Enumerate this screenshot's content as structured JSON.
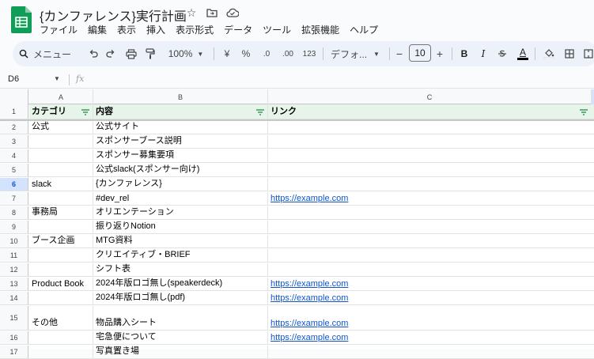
{
  "app": {
    "title": "{カンファレンス}実行計画",
    "brand_color": "#0f9d58"
  },
  "menu": [
    "ファイル",
    "編集",
    "表示",
    "挿入",
    "表示形式",
    "データ",
    "ツール",
    "拡張機能",
    "ヘルプ"
  ],
  "toolbar": {
    "search_label": "メニュー",
    "zoom": "100%",
    "currency": "¥",
    "percent": "%",
    "dec_decrease": ".0",
    "dec_increase": ".00",
    "number_format": "123",
    "font": "デフォ...",
    "font_size": "10",
    "bold": "B",
    "italic": "I"
  },
  "formula_bar": {
    "cell_ref": "D6",
    "fx": "fx"
  },
  "columns": [
    "A",
    "B",
    "C"
  ],
  "header_row": {
    "num": "1",
    "a": "カテゴリ",
    "b": "内容",
    "c": "リンク"
  },
  "rows": [
    {
      "num": "2",
      "a": "公式",
      "b": "公式サイト",
      "c": ""
    },
    {
      "num": "3",
      "a": "",
      "b": "スポンサーブース説明",
      "c": ""
    },
    {
      "num": "4",
      "a": "",
      "b": "スポンサー募集要項",
      "c": ""
    },
    {
      "num": "5",
      "a": "",
      "b": "公式slack(スポンサー向け)",
      "c": ""
    },
    {
      "num": "6",
      "a": "slack",
      "b": "{カンファレンス}",
      "c": ""
    },
    {
      "num": "7",
      "a": "",
      "b": "#dev_rel",
      "c": "https://example.com"
    },
    {
      "num": "8",
      "a": "事務局",
      "b": "オリエンテーション",
      "c": ""
    },
    {
      "num": "9",
      "a": "",
      "b": "振り返りNotion",
      "c": ""
    },
    {
      "num": "10",
      "a": "ブース企画",
      "b": "MTG資料",
      "c": ""
    },
    {
      "num": "11",
      "a": "",
      "b": "クリエイティブ・BRIEF",
      "c": ""
    },
    {
      "num": "12",
      "a": "",
      "b": "シフト表",
      "c": ""
    },
    {
      "num": "13",
      "a": "Product Book",
      "b": "2024年版ロゴ無し(speakerdeck)",
      "c": "https://example.com"
    },
    {
      "num": "14",
      "a": "",
      "b": "2024年版ロゴ無し(pdf)",
      "c": "https://example.com"
    },
    {
      "num": "15",
      "a": "その他",
      "b": "物品購入シート",
      "c": "https://example.com"
    },
    {
      "num": "16",
      "a": "",
      "b": "宅急便について",
      "c": "https://example.com"
    },
    {
      "num": "17",
      "a": "",
      "b": "写真置き場",
      "c": ""
    }
  ]
}
